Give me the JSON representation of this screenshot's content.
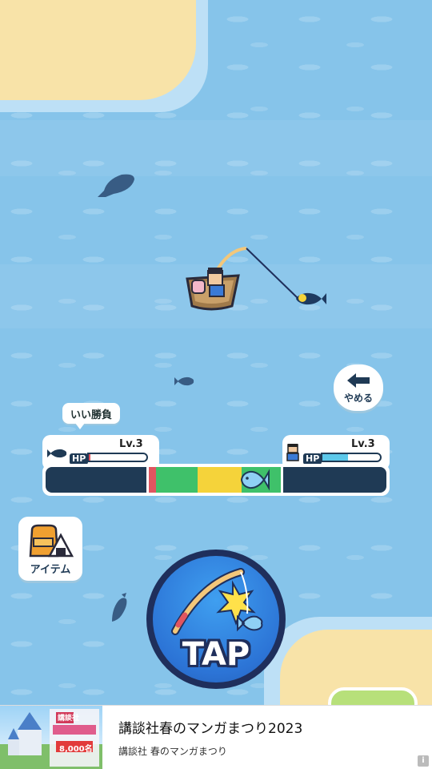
{
  "hud": {
    "quit_label": "やめる",
    "mood_label": "いい勝負",
    "item_label": "アイテム",
    "tap_label": "TAP"
  },
  "fish_status": {
    "level": "Lv.3",
    "hp_label": "HP",
    "hp_fraction": 0.03,
    "bar_color": "#e0505a"
  },
  "player_status": {
    "level": "Lv.3",
    "hp_label": "HP",
    "hp_fraction": 0.45,
    "bar_color": "#5cc8ea"
  },
  "tension": {
    "zones": [
      {
        "name": "danger",
        "color": "#e05560"
      },
      {
        "name": "good",
        "color": "#3fc16a"
      },
      {
        "name": "best",
        "color": "#f5d33a"
      },
      {
        "name": "good",
        "color": "#3fc16a"
      }
    ],
    "indicator_position": 0.58
  },
  "ad": {
    "title": "講談社春のマンガまつり2023",
    "subtitle": "講談社 春のマンガまつり",
    "thumb_text": "講談社",
    "thumb_price": "8,000名",
    "info_icon": "i"
  },
  "colors": {
    "water": "#86c4ea",
    "sand": "#f8e3a8",
    "navy": "#1f3a55"
  },
  "icons": [
    "back-arrow-icon",
    "fish-icon",
    "player-icon",
    "backpack-onigiri-icon",
    "fishing-rod-icon"
  ]
}
